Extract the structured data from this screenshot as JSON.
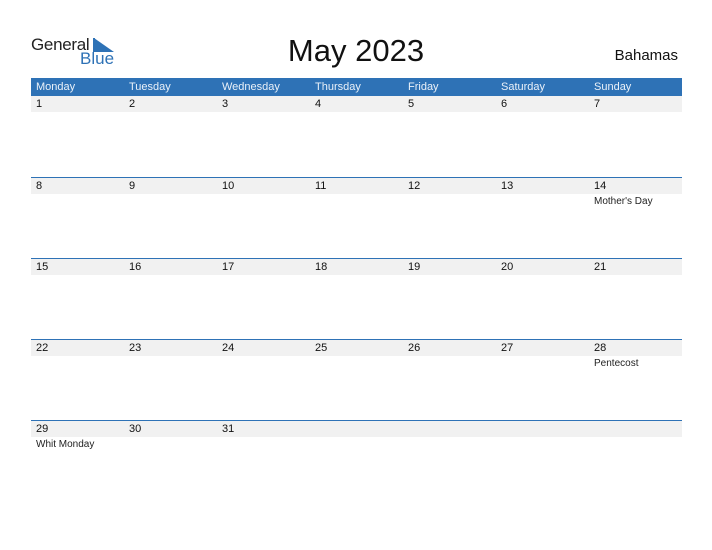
{
  "logo": {
    "general": "General",
    "blue": "Blue"
  },
  "title": "May 2023",
  "country": "Bahamas",
  "colors": {
    "accent": "#2e72b6",
    "band": "#f1f1f1"
  },
  "weekdays": [
    "Monday",
    "Tuesday",
    "Wednesday",
    "Thursday",
    "Friday",
    "Saturday",
    "Sunday"
  ],
  "weeks": [
    {
      "days": [
        "1",
        "2",
        "3",
        "4",
        "5",
        "6",
        "7"
      ],
      "events": [
        "",
        "",
        "",
        "",
        "",
        "",
        ""
      ]
    },
    {
      "days": [
        "8",
        "9",
        "10",
        "11",
        "12",
        "13",
        "14"
      ],
      "events": [
        "",
        "",
        "",
        "",
        "",
        "",
        "Mother's Day"
      ]
    },
    {
      "days": [
        "15",
        "16",
        "17",
        "18",
        "19",
        "20",
        "21"
      ],
      "events": [
        "",
        "",
        "",
        "",
        "",
        "",
        ""
      ]
    },
    {
      "days": [
        "22",
        "23",
        "24",
        "25",
        "26",
        "27",
        "28"
      ],
      "events": [
        "",
        "",
        "",
        "",
        "",
        "",
        "Pentecost"
      ]
    },
    {
      "days": [
        "29",
        "30",
        "31",
        "",
        "",
        "",
        ""
      ],
      "events": [
        "Whit Monday",
        "",
        "",
        "",
        "",
        "",
        ""
      ]
    }
  ]
}
